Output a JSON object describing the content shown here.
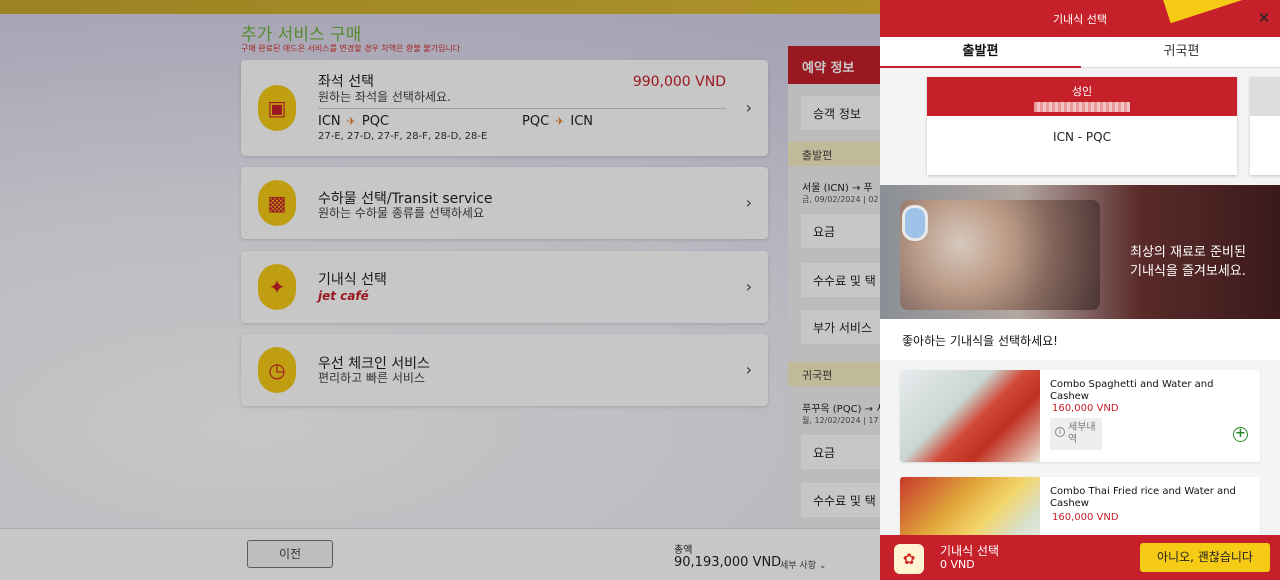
{
  "page": {
    "title": "추가 서비스 구매",
    "notice": "구매 완료된 애드온 서비스를 변경할 경우 차액은 환불 불가입니다"
  },
  "services": {
    "seat": {
      "title": "좌석 선택",
      "desc": "원하는 좌석을 선택하세요.",
      "price": "990,000 VND",
      "route1_from": "ICN",
      "route1_to": "PQC",
      "route2_from": "PQC",
      "route2_to": "ICN",
      "seats": "27-E, 27-D, 27-F, 28-F, 28-D, 28-E"
    },
    "baggage": {
      "title": "수하물 선택/Transit service",
      "desc": "원하는 수하물 종류를 선택하세요"
    },
    "meal": {
      "title": "기내식 선택",
      "brand": "jet café"
    },
    "checkin": {
      "title": "우선 체크인 서비스",
      "desc": "편리하고 빠른 서비스"
    }
  },
  "booking": {
    "title": "예약 정보",
    "passenger_info": "승객 정보",
    "departure_label": "출발편",
    "departure_route": "서울 (ICN) → 푸",
    "departure_date": "금, 09/02/2024 | 02",
    "fare": "요금",
    "fees": "수수료 및 택",
    "addons": "부가 서비스",
    "return_label": "귀국편",
    "return_route": "푸꾸옥 (PQC) → 서",
    "return_date": "월, 12/02/2024 | 17",
    "fare2": "요금",
    "fees2": "수수료 및 택"
  },
  "bottom": {
    "prev": "이전",
    "total_label": "총액",
    "total_amount": "90,193,000 VND",
    "detail": "세부 사항 ⌄"
  },
  "panel": {
    "title": "기내식 선택",
    "close": "✕",
    "tabs": [
      "출발편",
      "귀국편"
    ],
    "pax_type": "성인",
    "pax_route": "ICN - PQC",
    "banner_text_1": "최상의 재료로 준비된",
    "banner_text_2": "기내식을 즐겨보세요.",
    "choose_title": "좋아하는 기내식을 선택하세요!",
    "meals": [
      {
        "name": "Combo Spaghetti and Water and Cashew",
        "price": "160,000 VND",
        "detail": "세부내역",
        "add": "+"
      },
      {
        "name": "Combo Thai Fried rice and Water and Cashew",
        "price": "160,000 VND"
      }
    ],
    "footer": {
      "title": "기내식 선택",
      "amount": "0 VND",
      "decline": "아니오, 괜찮습니다"
    }
  },
  "colors": {
    "brand_red": "#c6202b",
    "brand_yellow": "#f6cb16",
    "green": "#6cb43c"
  },
  "icons": [
    "seat-icon",
    "luggage-icon",
    "meal-icon",
    "stopwatch-icon",
    "plane-icon",
    "chevron-right-icon",
    "close-icon",
    "info-icon",
    "add-icon",
    "meal-basket-icon"
  ]
}
